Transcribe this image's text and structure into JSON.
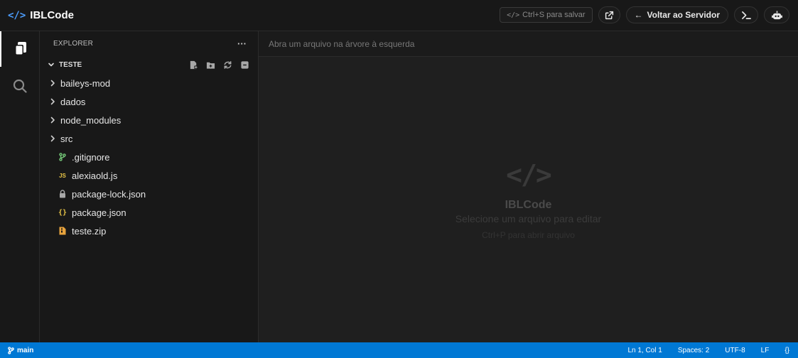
{
  "header": {
    "brand_icon": "</>",
    "title": "IBLCode",
    "save_hint": "Ctrl+S para salvar",
    "back_label": "Voltar ao Servidor",
    "icons": [
      "external-link-icon",
      "terminal-icon",
      "bot-icon"
    ]
  },
  "activity_bar": {
    "items": [
      {
        "icon": "files-icon",
        "active": true
      },
      {
        "icon": "search-icon",
        "active": false
      }
    ]
  },
  "sidebar": {
    "title": "EXPLORER",
    "more": "···",
    "folder": "TESTE",
    "folder_tools": [
      "new-file-icon",
      "new-folder-icon",
      "refresh-icon",
      "collapse-icon"
    ],
    "directories": [
      {
        "name": "baileys-mod"
      },
      {
        "name": "dados"
      },
      {
        "name": "node_modules"
      },
      {
        "name": "src"
      }
    ],
    "files": [
      {
        "name": ".gitignore",
        "icon": "git-icon",
        "color": "#6fbf73"
      },
      {
        "name": "alexiaold.js",
        "icon": "js-icon",
        "color": "#e8c547"
      },
      {
        "name": "package-lock.json",
        "icon": "lock-icon",
        "color": "#a8a8a8"
      },
      {
        "name": "package.json",
        "icon": "json-icon",
        "color": "#e8c547"
      },
      {
        "name": "teste.zip",
        "icon": "zip-icon",
        "color": "#e8a33d"
      }
    ]
  },
  "editor": {
    "placeholder": "Abra um arquivo na árvore à esquerda",
    "welcome": {
      "logo": "</>",
      "title": "IBLCode",
      "subtitle": "Selecione um arquivo para editar",
      "hint": "Ctrl+P para abrir arquivo"
    }
  },
  "statusbar": {
    "branch": "main",
    "position": "Ln 1, Col 1",
    "spaces": "Spaces: 2",
    "encoding": "UTF-8",
    "eol": "LF",
    "format": "{}"
  },
  "colors": {
    "accent": "#0078d4",
    "brand": "#4c9eff"
  }
}
